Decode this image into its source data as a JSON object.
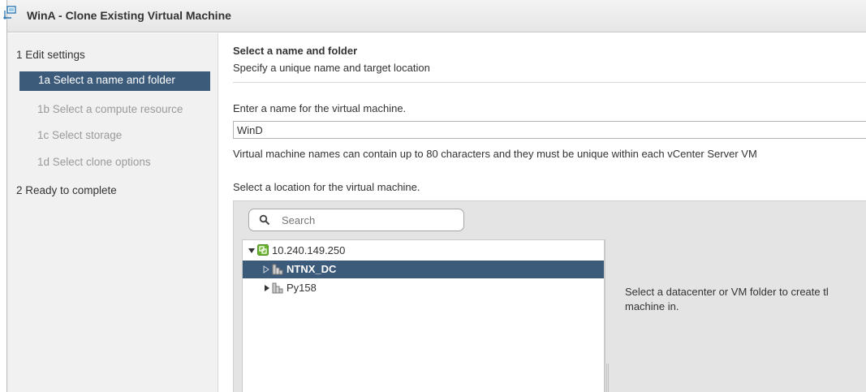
{
  "window": {
    "title": "WinA - Clone Existing Virtual Machine",
    "icon": "clone-vm-icon"
  },
  "sidebar": {
    "steps": [
      {
        "label": "1  Edit settings",
        "state": "section"
      },
      {
        "label": "1a  Select a name and folder",
        "state": "active"
      },
      {
        "label": "1b  Select a compute resource",
        "state": "disabled"
      },
      {
        "label": "1c  Select storage",
        "state": "disabled"
      },
      {
        "label": "1d  Select clone options",
        "state": "disabled"
      },
      {
        "label": "2  Ready to complete",
        "state": "section"
      }
    ]
  },
  "header": {
    "title": "Select a name and folder",
    "subtitle": "Specify a unique name and target location"
  },
  "name_section": {
    "label": "Enter a name for the virtual machine.",
    "value": "WinD",
    "help": "Virtual machine names can contain up to 80 characters and they must be unique within each vCenter Server VM"
  },
  "location_section": {
    "label": "Select a location for the virtual machine.",
    "search_placeholder": "Search",
    "tree": [
      {
        "label": "10.240.149.250",
        "icon": "vcenter-icon",
        "expanded": true,
        "selected": false
      },
      {
        "label": "NTNX_DC",
        "icon": "datacenter-icon",
        "expanded": false,
        "selected": true
      },
      {
        "label": "Py158",
        "icon": "datacenter-icon",
        "expanded": false,
        "selected": false
      }
    ],
    "hint": "Select a datacenter or VM folder to create tl machine in."
  },
  "colors": {
    "selection": "#3c5a7a",
    "sidebar_bg": "#f1f1f1",
    "panel_bg": "#e4e4e4",
    "vcenter_green": "#6ab42d"
  }
}
